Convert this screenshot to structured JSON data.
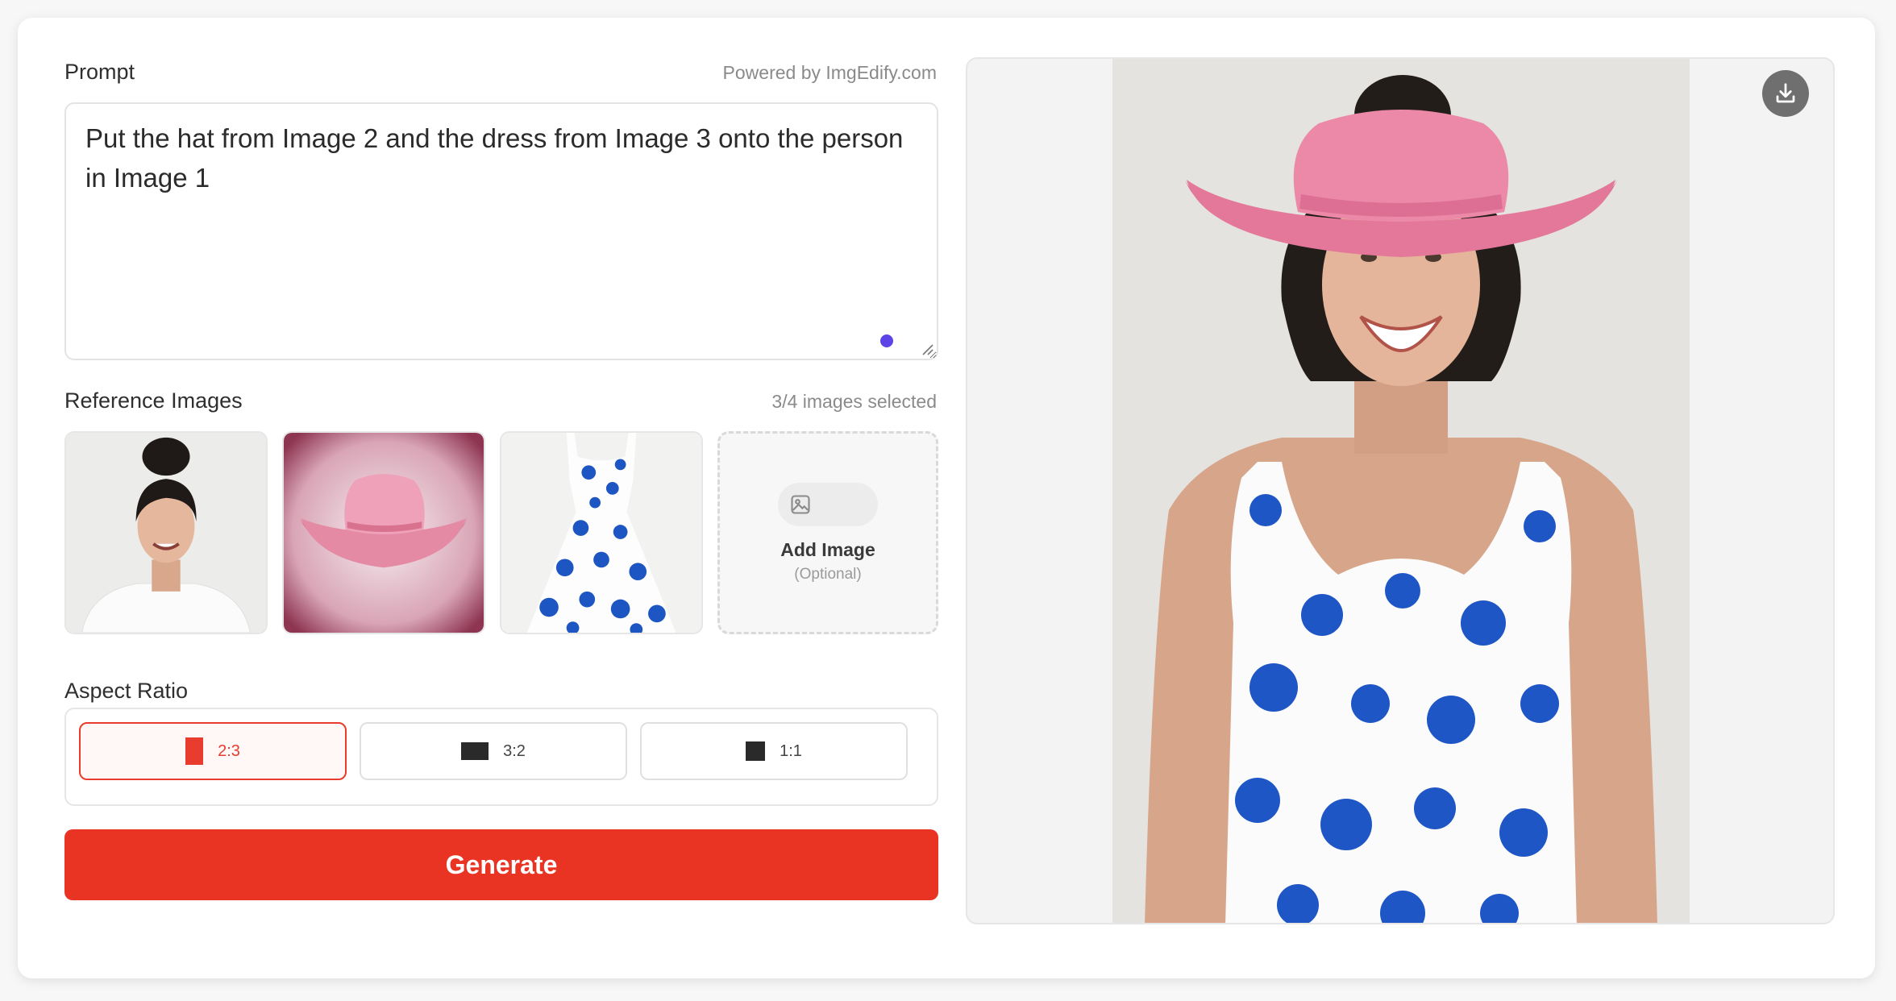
{
  "prompt": {
    "label": "Prompt",
    "powered_by": "Powered by ImgEdify.com",
    "text": "Put the hat from Image 2 and the dress from Image 3 onto the person in Image 1"
  },
  "reference": {
    "label": "Reference Images",
    "count_text": "3/4 images selected",
    "images": [
      {
        "icon": "woman-portrait-image"
      },
      {
        "icon": "pink-cowboy-hat-image"
      },
      {
        "icon": "blue-floral-dress-image"
      }
    ],
    "add_label": "Add Image",
    "add_sub": "(Optional)"
  },
  "aspect": {
    "label": "Aspect Ratio",
    "options": [
      {
        "label": "2:3",
        "selected": true
      },
      {
        "label": "3:2",
        "selected": false
      },
      {
        "label": "1:1",
        "selected": false
      }
    ]
  },
  "generate_label": "Generate",
  "result": {
    "icon": "generated-woman-pink-hat-floral-dress-image",
    "download_icon": "download-icon"
  },
  "colors": {
    "accent": "#e93424",
    "dot": "#5d44e6"
  }
}
